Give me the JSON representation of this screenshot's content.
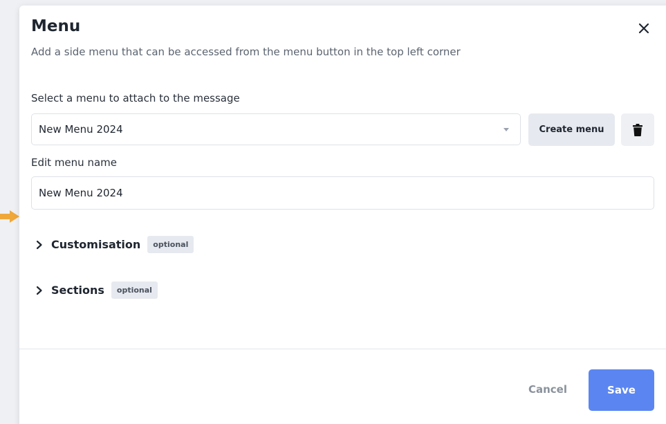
{
  "modal": {
    "title": "Menu",
    "subtitle": "Add a side menu that can be accessed from the menu button in the top left corner"
  },
  "menu_select": {
    "label": "Select a menu to attach to the message",
    "selected_value": "New Menu 2024",
    "create_button_label": "Create menu"
  },
  "menu_name": {
    "label": "Edit menu name",
    "value": "New Menu 2024"
  },
  "sections": [
    {
      "label": "Customisation",
      "badge": "optional",
      "expanded": false
    },
    {
      "label": "Sections",
      "badge": "optional",
      "expanded": false
    }
  ],
  "footer": {
    "cancel_label": "Cancel",
    "save_label": "Save"
  },
  "colors": {
    "primary": "#5b86f2",
    "pointer_arrow": "#f0a73a"
  },
  "icons": {
    "close": "close-icon",
    "trash": "trash-icon",
    "dropdown": "caret-down-icon",
    "expand": "chevron-right-icon"
  }
}
